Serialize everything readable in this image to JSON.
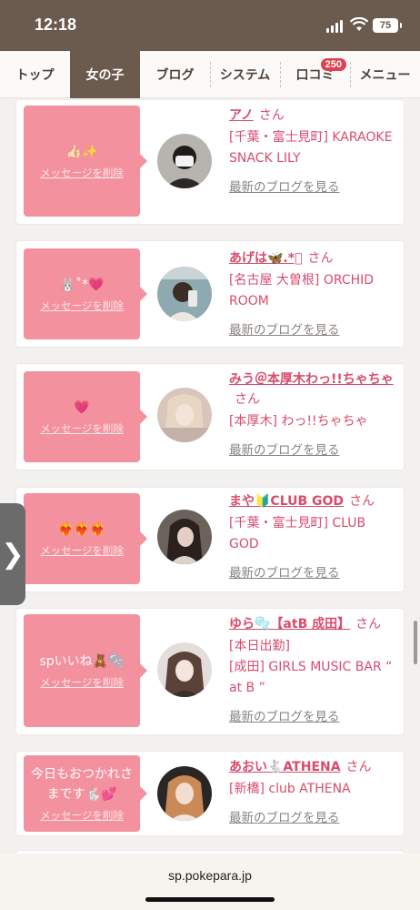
{
  "status": {
    "time": "12:18",
    "battery": "75"
  },
  "nav": {
    "tabs": [
      {
        "label": "トップ"
      },
      {
        "label": "女の子"
      },
      {
        "label": "ブログ"
      },
      {
        "label": "システム"
      },
      {
        "label": "口コミ",
        "badge": "250"
      },
      {
        "label": "メニュー"
      }
    ],
    "active_tab": "女の子"
  },
  "cards": [
    {
      "message": "👍🏻✨",
      "delete_label": "メッセージを削除",
      "name": "アノ",
      "honorific": "さん",
      "shop": "[千葉・富士見町] KARAOKE SNACK LILY",
      "blog_link": "最新のブログを見る"
    },
    {
      "message": "🐰˚*💗",
      "delete_label": "メッセージを削除",
      "name": "あげは🦋.*ﾟ",
      "honorific": "さん",
      "shop": "[名古屋 大曽根] ORCHID ROOM",
      "blog_link": "最新のブログを見る"
    },
    {
      "message": "💗",
      "delete_label": "メッセージを削除",
      "name": "みう＠本厚木わっ!!ちゃちゃ",
      "honorific": "さん",
      "shop": "[本厚木] わっ!!ちゃちゃ",
      "blog_link": "最新のブログを見る"
    },
    {
      "message": "❤️‍🔥❤️‍🔥❤️‍🔥",
      "delete_label": "メッセージを削除",
      "name": "まや🔰CLUB GOD",
      "honorific": "さん",
      "shop": "[千葉・富士見町] CLUB GOD",
      "blog_link": "最新のブログを見る"
    },
    {
      "message": "spいいね🧸🫧",
      "delete_label": "メッセージを削除",
      "name": "ゆら🫧【atB 成田】",
      "honorific": "さん",
      "shop": "[本日出勤]\n[成田] GIRLS MUSIC BAR “ at B ”",
      "blog_link": "最新のブログを見る"
    },
    {
      "message": "今日もおつかれさまです🐇💕",
      "delete_label": "メッセージを削除",
      "name": "あおい🐇ATHENA",
      "honorific": "さん",
      "shop": "[新橋] club ATHENA",
      "blog_link": "最新のブログを見る"
    }
  ],
  "url": "sp.pokepara.jp",
  "colors": {
    "accent": "#d94c6b",
    "bubble": "#f4919e",
    "nav_active": "#6b5a4e",
    "badge": "#e0414f"
  }
}
